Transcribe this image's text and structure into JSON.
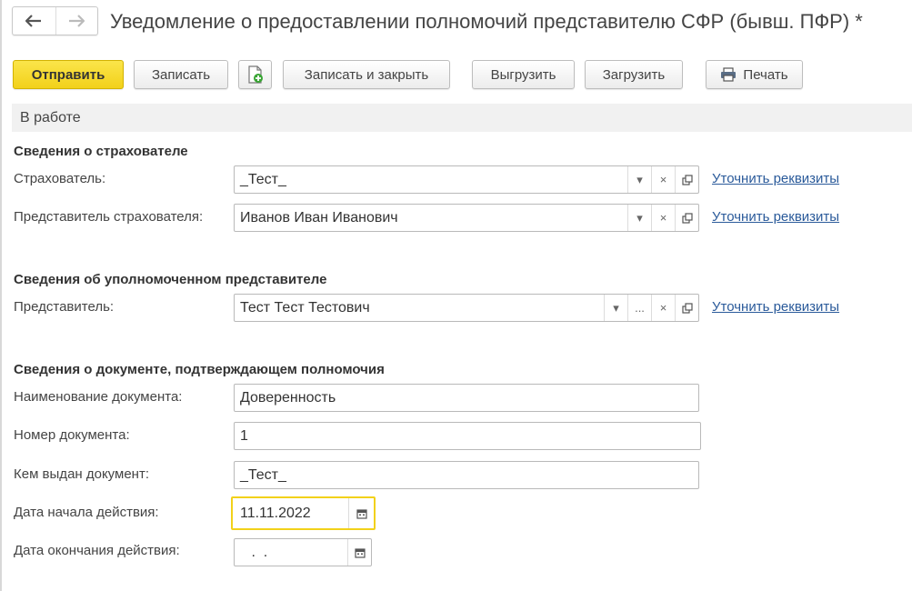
{
  "window": {
    "title": "Уведомление о предоставлении полномочий представителю СФР (бывш. ПФР) *"
  },
  "toolbar": {
    "send_label": "Отправить",
    "save_label": "Записать",
    "save_close_label": "Записать и закрыть",
    "export_label": "Выгрузить",
    "import_label": "Загрузить",
    "print_label": "Печать"
  },
  "status": {
    "text": "В работе"
  },
  "insurer_section": {
    "heading": "Сведения о страхователе",
    "insurer": {
      "label": "Страхователь:",
      "value": "_Тест_",
      "link": "Уточнить реквизиты"
    },
    "insurer_rep": {
      "label": "Представитель страхователя:",
      "value": "Иванов Иван Иванович",
      "link": "Уточнить реквизиты"
    }
  },
  "rep_section": {
    "heading": "Сведения об уполномоченном представителе",
    "rep": {
      "label": "Представитель:",
      "value": "Тест Тест Тестович",
      "ellipsis": "...",
      "link": "Уточнить реквизиты"
    }
  },
  "doc_section": {
    "heading": "Сведения о документе, подтверждающем полномочия",
    "doc_name": {
      "label": "Наименование документа:",
      "value": "Доверенность"
    },
    "doc_number": {
      "label": "Номер документа:",
      "value": "1"
    },
    "issued_by": {
      "label": "Кем выдан документ:",
      "value": "_Тест_"
    },
    "start_date": {
      "label": "Дата начала действия:",
      "value": "11.11.2022"
    },
    "end_date": {
      "label": "Дата окончания действия:",
      "value": " .  ."
    }
  },
  "icons": {
    "back": "arrow-left-icon",
    "forward": "arrow-right-icon",
    "new_doc": "add-document-icon",
    "print": "printer-icon",
    "dropdown": "triangle-down-icon",
    "clear": "x-icon",
    "open": "open-window-icon",
    "calendar": "calendar-icon"
  },
  "colors": {
    "accent": "#f2d11a",
    "link": "#2a5a9a",
    "status_bg": "#f1f1f1"
  }
}
